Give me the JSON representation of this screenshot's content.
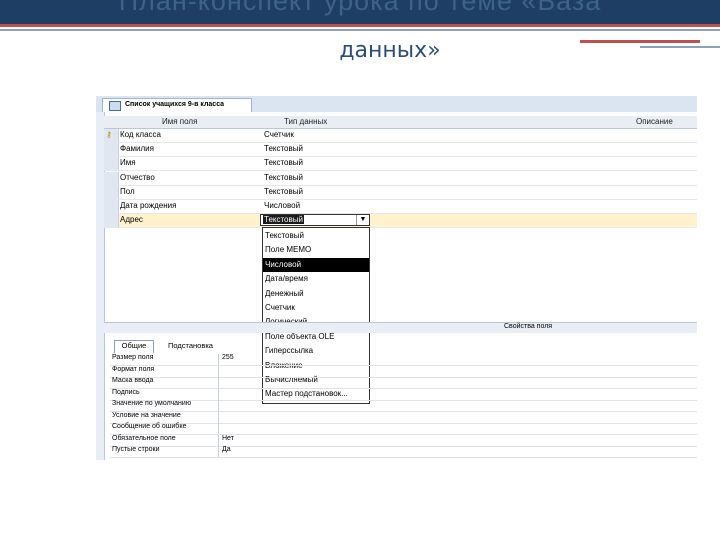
{
  "slide": {
    "title_line1": "План-конспект урока по теме «База",
    "title_line2": "данных»"
  },
  "access": {
    "tab_title": "Список учащихся 9-в класса",
    "columns": {
      "field_name": "Имя поля",
      "data_type": "Тип данных",
      "description": "Описание"
    },
    "rows": [
      {
        "name": "Код класса",
        "type": "Счетчик"
      },
      {
        "name": "Фамилия",
        "type": "Текстовый"
      },
      {
        "name": "Имя",
        "type": "Текстовый"
      },
      {
        "name": "Отчество",
        "type": "Текстовый"
      },
      {
        "name": "Пол",
        "type": "Текстовый"
      },
      {
        "name": "Дата рождения",
        "type": "Числовой"
      },
      {
        "name": "Адрес",
        "type": "Текстовый"
      }
    ],
    "combo_value": "Текстовый",
    "dropdown_options": [
      "Текстовый",
      "Поле МЕМО",
      "Числовой",
      "Дата/время",
      "Денежный",
      "Счетчик",
      "Логический",
      "Поле объекта OLE",
      "Гиперссылка",
      "Вложение",
      "Вычисляемый",
      "Мастер подстановок..."
    ],
    "highlighted_option": "Числовой",
    "field_properties_title": "Свойства поля",
    "prop_tabs": {
      "general": "Общие",
      "lookup": "Подстановка"
    },
    "properties": [
      {
        "label": "Размер поля",
        "value": "255"
      },
      {
        "label": "Формат поля",
        "value": ""
      },
      {
        "label": "Маска ввода",
        "value": ""
      },
      {
        "label": "Подпись",
        "value": ""
      },
      {
        "label": "Значение по умолчанию",
        "value": ""
      },
      {
        "label": "Условие на значение",
        "value": ""
      },
      {
        "label": "Сообщение об ошибке",
        "value": ""
      },
      {
        "label": "Обязательное поле",
        "value": "Нет"
      },
      {
        "label": "Пустые строки",
        "value": "Да"
      }
    ]
  }
}
